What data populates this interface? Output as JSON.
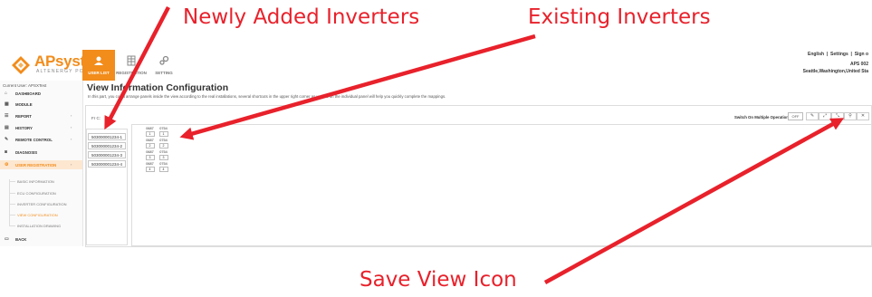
{
  "annotations": {
    "newly_added": "Newly Added Inverters",
    "existing": "Existing Inverters",
    "save_view": "Save View Icon"
  },
  "brand": {
    "name": "APsystems",
    "tagline": "ALTENERGY POWER",
    "color": "#f28c1b"
  },
  "nav": {
    "tabs": [
      {
        "label": "USER LIST",
        "icon": "users-icon",
        "active": true
      },
      {
        "label": "REGISTRATION",
        "icon": "grid-icon",
        "active": false
      },
      {
        "label": "SETTING",
        "icon": "gears-icon",
        "active": false
      }
    ]
  },
  "top_links": {
    "language": "English",
    "sep1": "|",
    "settings": "Settings",
    "sep2": "|",
    "sign_out": "Sign o"
  },
  "plant": {
    "id": "APS 002",
    "location": "Seattle,Washington,United Sta"
  },
  "sidebar": {
    "current_user": "Current User: APSXTest",
    "items": [
      {
        "label": "DASHBOARD",
        "icon": "home-icon"
      },
      {
        "label": "MODULE",
        "icon": "grid-icon"
      },
      {
        "label": "REPORT",
        "icon": "list-icon",
        "chevron": "‹"
      },
      {
        "label": "HISTORY",
        "icon": "calendar-icon",
        "chevron": "‹"
      },
      {
        "label": "REMOTE CONTROL",
        "icon": "wrench-icon",
        "chevron": "‹"
      },
      {
        "label": "DIAGNOSIS",
        "icon": "camera-icon"
      },
      {
        "label": "USER REGISTRATION",
        "icon": "gears-icon",
        "chevron": "‹",
        "active": true
      }
    ],
    "sub_items": [
      {
        "label": "BASIC INFORMATION"
      },
      {
        "label": "ECU CONFIGURATION"
      },
      {
        "label": "INVERTER CONFIGURATION"
      },
      {
        "label": "VIEW CONFIGURATION",
        "active": true
      },
      {
        "label": "INSTALLATION DRAWING"
      }
    ],
    "back": {
      "label": "BACK",
      "icon": "back-icon"
    }
  },
  "main": {
    "title": "View Information Configuration",
    "description": "In this part, you could arrange panels inside the view according to the real installations, several shortcuts in the upper right corner as well as on the individual panel will help you quickly complete the mappings.",
    "filter_label": "Fr C:",
    "new_inverters": [
      "503000001234-1",
      "503000001234-2",
      "503000001234-3",
      "503000001234-4"
    ],
    "panels": [
      {
        "id": "0687",
        "num": "1"
      },
      {
        "id": "0754",
        "num": "1"
      },
      {
        "id": "0687",
        "num": "2"
      },
      {
        "id": "0754",
        "num": "2"
      },
      {
        "id": "0687",
        "num": "3"
      },
      {
        "id": "0754",
        "num": "3"
      },
      {
        "id": "0687",
        "num": "4"
      },
      {
        "id": "0754",
        "num": "4"
      }
    ],
    "switch_label": "Switch On Multiple Operation",
    "toggle": "OFF",
    "tools": [
      {
        "icon": "pencil-icon",
        "glyph": "✎"
      },
      {
        "icon": "expand-icon",
        "glyph": "⤢"
      },
      {
        "icon": "zoom-icon",
        "glyph": "⤡"
      },
      {
        "icon": "search-icon",
        "glyph": "⚲"
      },
      {
        "icon": "bin-icon",
        "glyph": "✕"
      },
      {
        "icon": "save-icon",
        "glyph": "⎙"
      },
      {
        "icon": "exit-icon",
        "glyph": "▭"
      }
    ]
  },
  "colors": {
    "annotation": "#e8212b",
    "accent": "#f28c1b"
  }
}
